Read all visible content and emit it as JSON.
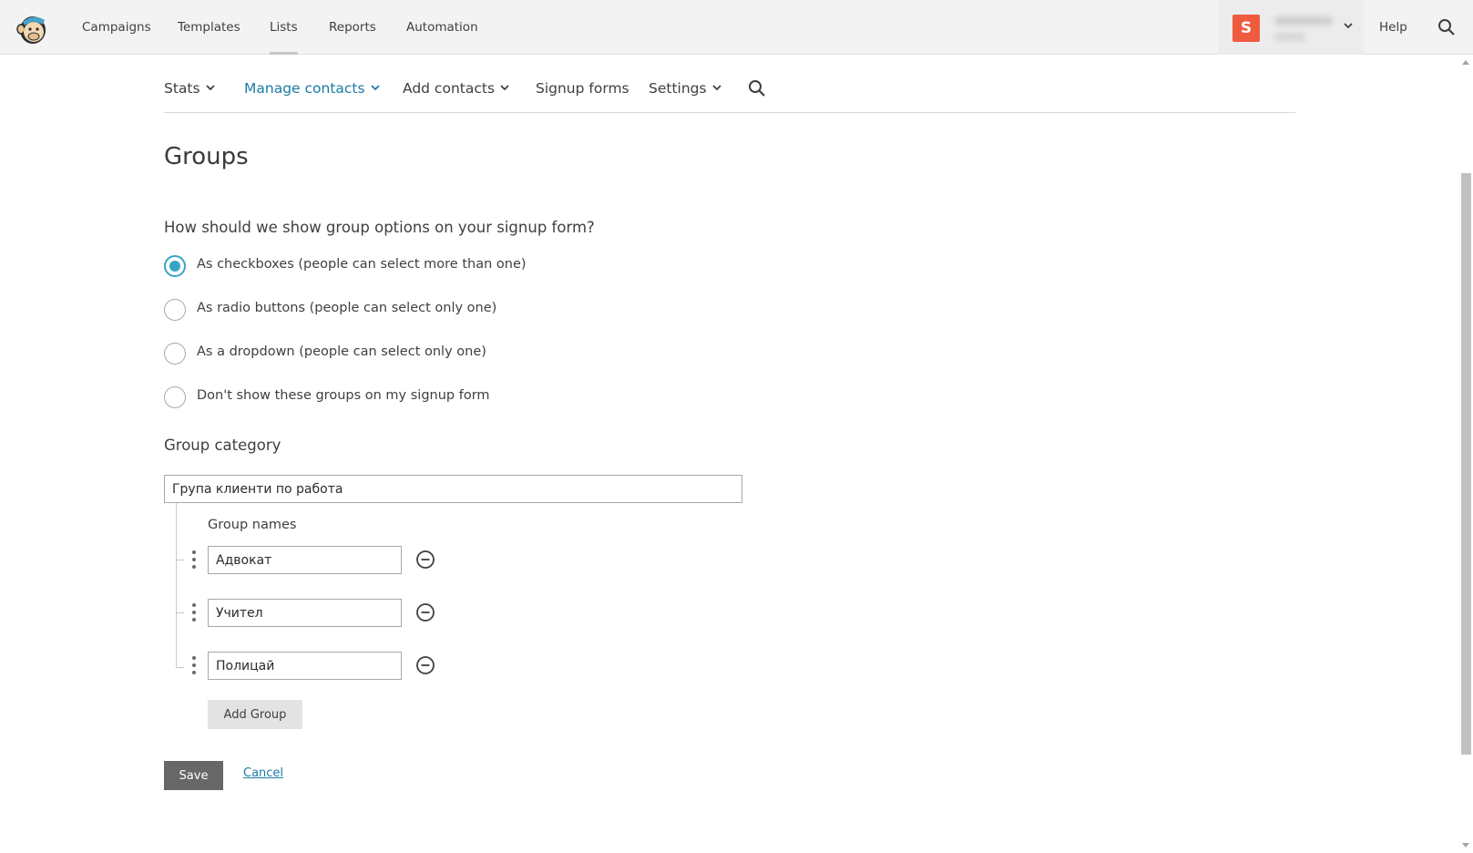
{
  "topnav": {
    "items": [
      {
        "label": "Campaigns"
      },
      {
        "label": "Templates"
      },
      {
        "label": "Lists"
      },
      {
        "label": "Reports"
      },
      {
        "label": "Automation"
      }
    ],
    "active": "Lists",
    "account_initial": "S",
    "help_label": "Help"
  },
  "subnav": {
    "items": [
      {
        "label": "Stats",
        "has_caret": true
      },
      {
        "label": "Manage contacts",
        "has_caret": true
      },
      {
        "label": "Add contacts",
        "has_caret": true
      },
      {
        "label": "Signup forms",
        "has_caret": false
      },
      {
        "label": "Settings",
        "has_caret": true
      }
    ],
    "active": "Manage contacts"
  },
  "page": {
    "title": "Groups",
    "question": "How should we show group options on your signup form?",
    "options": [
      {
        "label": "As checkboxes (people can select more than one)",
        "checked": true
      },
      {
        "label": "As radio buttons (people can select only one)",
        "checked": false
      },
      {
        "label": "As a dropdown (people can select only one)",
        "checked": false
      },
      {
        "label": "Don't show these groups on my signup form",
        "checked": false
      }
    ],
    "category_label": "Group category",
    "category_value": "Група клиенти по работа",
    "group_names_label": "Group names",
    "groups": [
      {
        "value": "Адвокат"
      },
      {
        "value": "Учител"
      },
      {
        "value": "Полицай"
      }
    ],
    "add_group_label": "Add Group",
    "save_label": "Save",
    "cancel_label": "Cancel"
  },
  "colors": {
    "accent": "#37a4c4",
    "link": "#1c7ba8",
    "avatar": "#ef5b3f",
    "save_button": "#676767"
  }
}
